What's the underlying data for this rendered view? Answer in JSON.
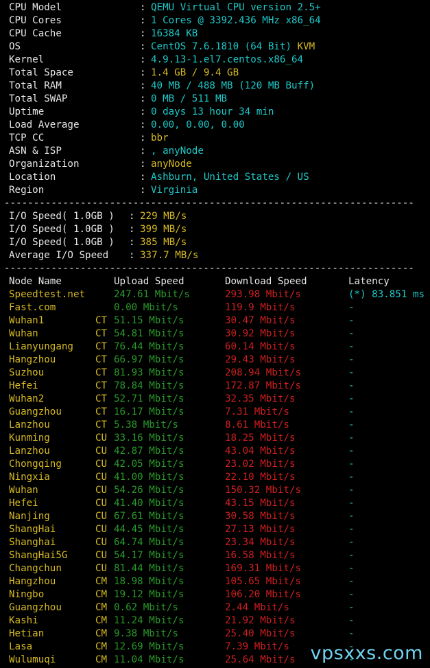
{
  "colors": {
    "white": "#e8e8e8",
    "cyan": "#1ec8c8",
    "yellow": "#d6ba24",
    "green": "#2a9a2a",
    "red": "#d01f1f",
    "watermark": "#6fd3f0"
  },
  "system_info": [
    {
      "label": "CPU Model",
      "value": "QEMU Virtual CPU version 2.5+",
      "color": "cyan"
    },
    {
      "label": "CPU Cores",
      "value": "1 Cores @ 3392.436 MHz x86_64",
      "color": "cyan"
    },
    {
      "label": "CPU Cache",
      "value": "16384 KB",
      "color": "cyan"
    },
    {
      "label": "OS",
      "value": "CentOS 7.6.1810 (64 Bit)",
      "color": "cyan",
      "extra": " KVM",
      "extra_color": "yellow"
    },
    {
      "label": "Kernel",
      "value": "4.9.13-1.el7.centos.x86_64",
      "color": "cyan"
    },
    {
      "label": "Total Space",
      "value": "1.4 GB / 9.4 GB",
      "color": "yellow"
    },
    {
      "label": "Total RAM",
      "value": "40 MB / 488 MB (120 MB Buff)",
      "color": "cyan"
    },
    {
      "label": "Total SWAP",
      "value": "0 MB / 511 MB",
      "color": "cyan"
    },
    {
      "label": "Uptime",
      "value": "0 days 13 hour 34 min",
      "color": "cyan"
    },
    {
      "label": "Load Average",
      "value": "0.00, 0.00, 0.00",
      "color": "cyan"
    },
    {
      "label": "TCP CC",
      "value": "bbr",
      "color": "yellow"
    },
    {
      "label": "ASN & ISP",
      "value": ", anyNode",
      "color": "cyan"
    },
    {
      "label": "Organization",
      "value": "anyNode",
      "color": "yellow"
    },
    {
      "label": "Location",
      "value": "Ashburn, United States / US",
      "color": "cyan"
    },
    {
      "label": "Region",
      "value": "Virginia",
      "color": "cyan"
    }
  ],
  "separator": "----------------------------------------------------------------------",
  "io_tests": [
    {
      "label": "I/O Speed( 1.0GB )",
      "value": "229 MB/s"
    },
    {
      "label": "I/O Speed( 1.0GB )",
      "value": "399 MB/s"
    },
    {
      "label": "I/O Speed( 1.0GB )",
      "value": "385 MB/s"
    },
    {
      "label": "Average I/O Speed",
      "value": "337.7 MB/s"
    }
  ],
  "speed_header": {
    "node": "Node Name",
    "upload": "Upload Speed",
    "download": "Download Speed",
    "latency": "Latency"
  },
  "speed_rows": [
    {
      "node": "Speedtest.net",
      "isp": "",
      "upload": "247.61 Mbit/s",
      "download": "293.98 Mbit/s",
      "latency": "(*) 83.851 ms"
    },
    {
      "node": "Fast.com",
      "isp": "",
      "upload": "0.00 Mbit/s",
      "download": "119.9 Mbit/s",
      "latency": "-"
    },
    {
      "node": "Wuhan1",
      "isp": "CT",
      "upload": "51.15 Mbit/s",
      "download": "30.47 Mbit/s",
      "latency": "-"
    },
    {
      "node": "Wuhan",
      "isp": "CT",
      "upload": "54.81 Mbit/s",
      "download": "30.92 Mbit/s",
      "latency": "-"
    },
    {
      "node": "Lianyungang",
      "isp": "CT",
      "upload": "76.44 Mbit/s",
      "download": "60.14 Mbit/s",
      "latency": "-"
    },
    {
      "node": "Hangzhou",
      "isp": "CT",
      "upload": "66.97 Mbit/s",
      "download": "29.43 Mbit/s",
      "latency": "-"
    },
    {
      "node": "Suzhou",
      "isp": "CT",
      "upload": "81.93 Mbit/s",
      "download": "208.94 Mbit/s",
      "latency": "-"
    },
    {
      "node": "Hefei",
      "isp": "CT",
      "upload": "78.84 Mbit/s",
      "download": "172.87 Mbit/s",
      "latency": "-"
    },
    {
      "node": "Wuhan2",
      "isp": "CT",
      "upload": "52.71 Mbit/s",
      "download": "32.35 Mbit/s",
      "latency": "-"
    },
    {
      "node": "Guangzhou",
      "isp": "CT",
      "upload": "16.17 Mbit/s",
      "download": "7.31 Mbit/s",
      "latency": "-"
    },
    {
      "node": "Lanzhou",
      "isp": "CT",
      "upload": "5.38 Mbit/s",
      "download": "8.61 Mbit/s",
      "latency": "-"
    },
    {
      "node": "Kunming",
      "isp": "CU",
      "upload": "33.16 Mbit/s",
      "download": "18.25 Mbit/s",
      "latency": "-"
    },
    {
      "node": "Lanzhou",
      "isp": "CU",
      "upload": "42.87 Mbit/s",
      "download": "43.04 Mbit/s",
      "latency": "-"
    },
    {
      "node": "Chongqing",
      "isp": "CU",
      "upload": "42.05 Mbit/s",
      "download": "23.02 Mbit/s",
      "latency": "-"
    },
    {
      "node": "Ningxia",
      "isp": "CU",
      "upload": "41.00 Mbit/s",
      "download": "22.10 Mbit/s",
      "latency": "-"
    },
    {
      "node": "Wuhan",
      "isp": "CU",
      "upload": "54.26 Mbit/s",
      "download": "150.32 Mbit/s",
      "latency": "-"
    },
    {
      "node": "Hefei",
      "isp": "CU",
      "upload": "41.40 Mbit/s",
      "download": "43.15 Mbit/s",
      "latency": "-"
    },
    {
      "node": "Nanjing",
      "isp": "CU",
      "upload": "67.61 Mbit/s",
      "download": "30.58 Mbit/s",
      "latency": "-"
    },
    {
      "node": "ShangHai",
      "isp": "CU",
      "upload": "44.45 Mbit/s",
      "download": "27.13 Mbit/s",
      "latency": "-"
    },
    {
      "node": "Shanghai",
      "isp": "CU",
      "upload": "64.74 Mbit/s",
      "download": "23.34 Mbit/s",
      "latency": "-"
    },
    {
      "node": "ShangHai5G",
      "isp": "CU",
      "upload": "54.17 Mbit/s",
      "download": "16.58 Mbit/s",
      "latency": "-"
    },
    {
      "node": "Changchun",
      "isp": "CU",
      "upload": "81.44 Mbit/s",
      "download": "169.31 Mbit/s",
      "latency": "-"
    },
    {
      "node": "Hangzhou",
      "isp": "CM",
      "upload": "18.98 Mbit/s",
      "download": "105.65 Mbit/s",
      "latency": "-"
    },
    {
      "node": "Ningbo",
      "isp": "CM",
      "upload": "19.12 Mbit/s",
      "download": "106.20 Mbit/s",
      "latency": "-"
    },
    {
      "node": "Guangzhou",
      "isp": "CM",
      "upload": "0.62 Mbit/s",
      "download": "2.44 Mbit/s",
      "latency": "-"
    },
    {
      "node": "Kashi",
      "isp": "CM",
      "upload": "11.24 Mbit/s",
      "download": "21.92 Mbit/s",
      "latency": "-"
    },
    {
      "node": "Hetian",
      "isp": "CM",
      "upload": "9.38 Mbit/s",
      "download": "25.40 Mbit/s",
      "latency": "-"
    },
    {
      "node": "Lasa",
      "isp": "CM",
      "upload": "12.69 Mbit/s",
      "download": "7.39 Mbit/s",
      "latency": "-"
    },
    {
      "node": "Wulumuqi",
      "isp": "CM",
      "upload": "11.04 Mbit/s",
      "download": "25.64 Mbit/s",
      "latency": "-"
    }
  ],
  "watermark": "vpsxxs.com"
}
